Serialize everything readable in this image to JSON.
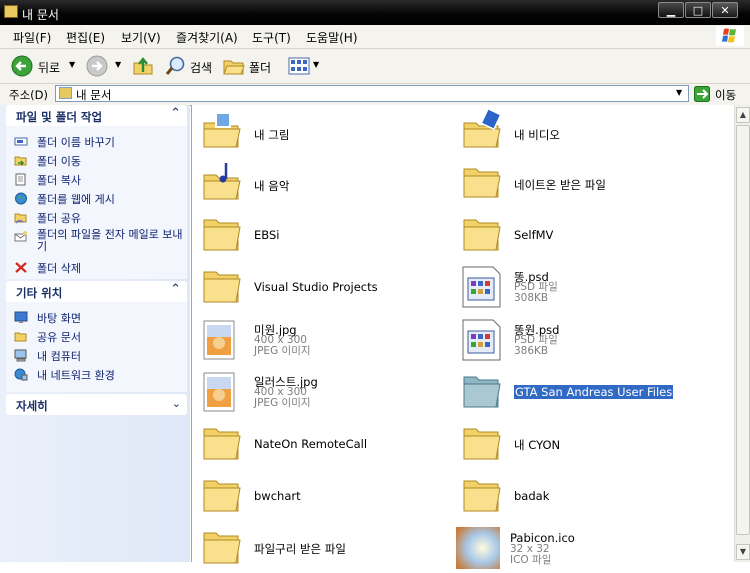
{
  "window": {
    "title": "내 문서",
    "controls": {
      "minimize": "▁",
      "maximize": "□",
      "close": "✕"
    }
  },
  "menu": [
    "파일(F)",
    "편집(E)",
    "보기(V)",
    "즐겨찾기(A)",
    "도구(T)",
    "도움말(H)"
  ],
  "toolbar": {
    "back": "뒤로",
    "search": "검색",
    "folders": "폴더"
  },
  "address": {
    "label": "주소(D)",
    "value": "내 문서",
    "go": "이동"
  },
  "panels": {
    "tasks": {
      "title": "파일 및 폴더 작업",
      "items": [
        "폴더 이름 바꾸기",
        "폴더 이동",
        "폴더 복사",
        "폴더를 웹에 게시",
        "폴더 공유",
        "폴더의 파일을 전자 메일로 보내기",
        "폴더 삭제"
      ]
    },
    "places": {
      "title": "기타 위치",
      "items": [
        "바탕 화면",
        "공유 문서",
        "내 컴퓨터",
        "내 네트워크 환경"
      ]
    },
    "details": {
      "title": "자세히"
    }
  },
  "items": [
    {
      "name": "내 그림",
      "type": "folder",
      "icon": "pictures-folder-icon"
    },
    {
      "name": "내 비디오",
      "type": "folder",
      "icon": "video-folder-icon"
    },
    {
      "name": "내 음악",
      "type": "folder",
      "icon": "music-folder-icon"
    },
    {
      "name": "네이트온 받은 파일",
      "type": "folder",
      "icon": "folder-icon"
    },
    {
      "name": "EBSi",
      "type": "folder",
      "icon": "folder-icon"
    },
    {
      "name": "SelfMV",
      "type": "folder",
      "icon": "folder-icon"
    },
    {
      "name": "Visual Studio Projects",
      "type": "folder",
      "icon": "folder-icon"
    },
    {
      "name": "똥.psd",
      "type": "PSD 파일",
      "size": "308KB",
      "icon": "psd-file-icon"
    },
    {
      "name": "미원.jpg",
      "dims": "400 x 300",
      "type": "JPEG 이미지",
      "icon": "jpeg-file-icon"
    },
    {
      "name": "똥원.psd",
      "type": "PSD 파일",
      "size": "386KB",
      "icon": "psd-file-icon"
    },
    {
      "name": "일러스트.jpg",
      "dims": "400 x 300",
      "type": "JPEG 이미지",
      "icon": "jpeg-file-icon"
    },
    {
      "name": "GTA San Andreas User Files",
      "type": "folder",
      "icon": "folder-icon",
      "selected": true
    },
    {
      "name": "NateOn RemoteCall",
      "type": "folder",
      "icon": "folder-icon"
    },
    {
      "name": "내 CYON",
      "type": "folder",
      "icon": "folder-icon"
    },
    {
      "name": "bwchart",
      "type": "folder",
      "icon": "folder-icon"
    },
    {
      "name": "badak",
      "type": "folder",
      "icon": "folder-icon"
    },
    {
      "name": "파일구리 받은 파일",
      "type": "folder",
      "icon": "folder-icon"
    },
    {
      "name": "Pabicon.ico",
      "dims": "32 x 32",
      "type": "ICO 파일",
      "icon": "ico-file-icon"
    }
  ],
  "colors": {
    "selection": "#316ac5",
    "folder": "#f2d268",
    "selected_folder": "#8fb7c4",
    "task_text": "#0b1f6e",
    "panel_bg": "#dfe8f7"
  }
}
